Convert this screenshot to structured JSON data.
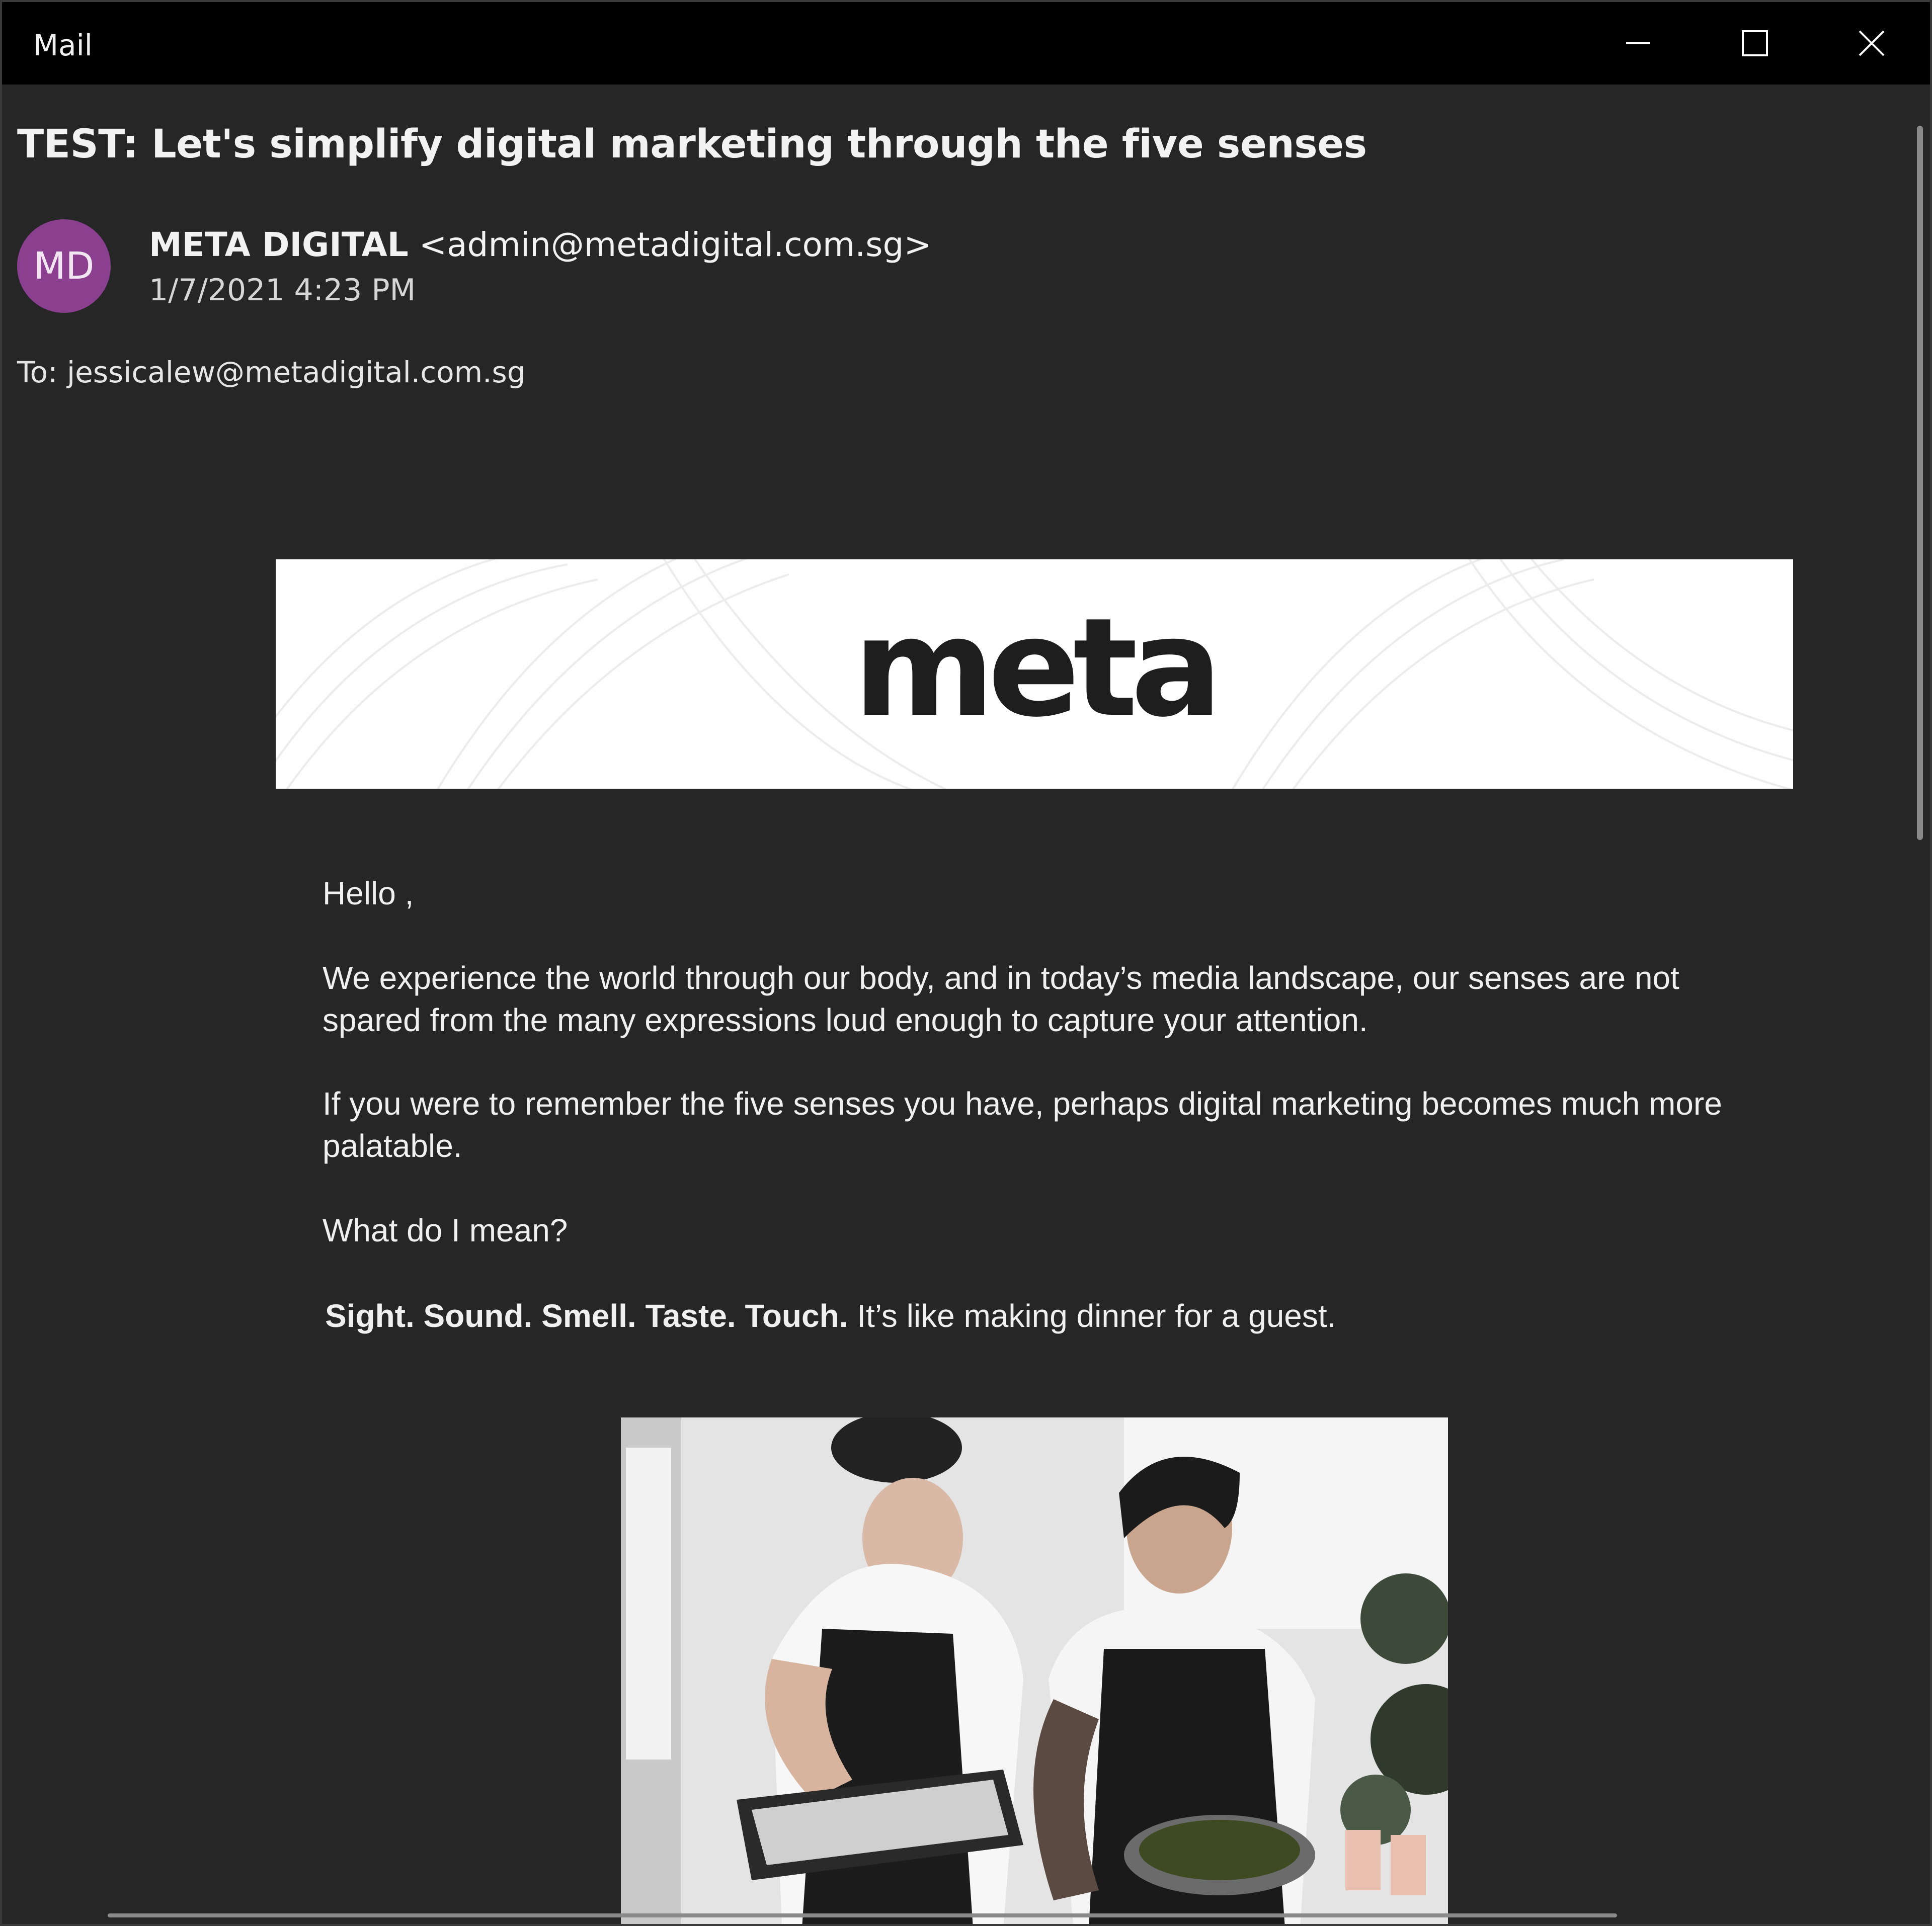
{
  "window": {
    "title": "Mail",
    "controls": {
      "minimize_icon": "minimize-icon",
      "maximize_icon": "maximize-icon",
      "close_icon": "close-icon"
    }
  },
  "message": {
    "subject": "TEST: Let's simplify digital marketing through the five senses",
    "sender": {
      "initials": "MD",
      "name": "META DIGITAL",
      "email": "<admin@metadigital.com.sg>",
      "avatar_color": "#8b3f8f"
    },
    "date": "1/7/2021 4:23 PM",
    "to": "To: jessicalew@metadigital.com.sg"
  },
  "body": {
    "banner_logo": "meta.",
    "greeting": "Hello ,",
    "paragraph1": "We experience the world through our body, and in today’s media landscape, our senses are not spared from the many expressions loud enough to capture your attention.",
    "paragraph2": "If you were to remember the five senses you have, perhaps digital marketing becomes much more palatable.",
    "paragraph3": "What do I mean?",
    "senses": {
      "bold": "Sight. Sound. Smell. Taste. Touch.",
      "rest": " It’s like making dinner for a guest."
    },
    "photo": "chefs-preparing-food-photo"
  },
  "colors": {
    "background": "#262626",
    "titlebar": "#000000",
    "text": "#f0f0f0"
  }
}
